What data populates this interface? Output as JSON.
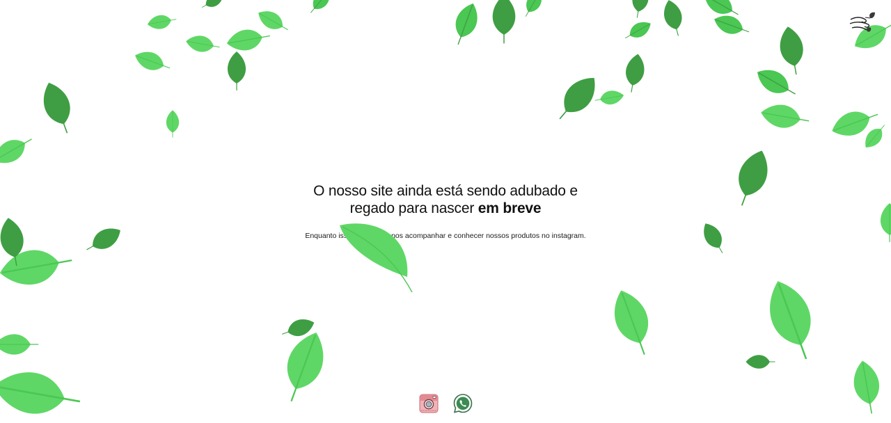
{
  "headline": {
    "line1": "O nosso site ainda está sendo adubado e",
    "line2_prefix": "regado para nascer ",
    "line2_bold": "em breve"
  },
  "subtext": "Enquanto isso, você pode nos acompanhar e conhecer nossos produtos no instagram.",
  "social": {
    "instagram": {
      "label": "Instagram",
      "icon": "instagram-icon"
    },
    "whatsapp": {
      "label": "WhatsApp",
      "icon": "whatsapp-icon"
    }
  },
  "brand": {
    "icon": "wind-leaves-logo-icon"
  },
  "colors": {
    "leaf_light": "#5fd766",
    "leaf_mid": "#4bc753",
    "leaf_dark": "#3f9e43",
    "text": "#111111",
    "instagram_pink": "#e9a3a8",
    "whatsapp_green": "#3b8b52"
  }
}
